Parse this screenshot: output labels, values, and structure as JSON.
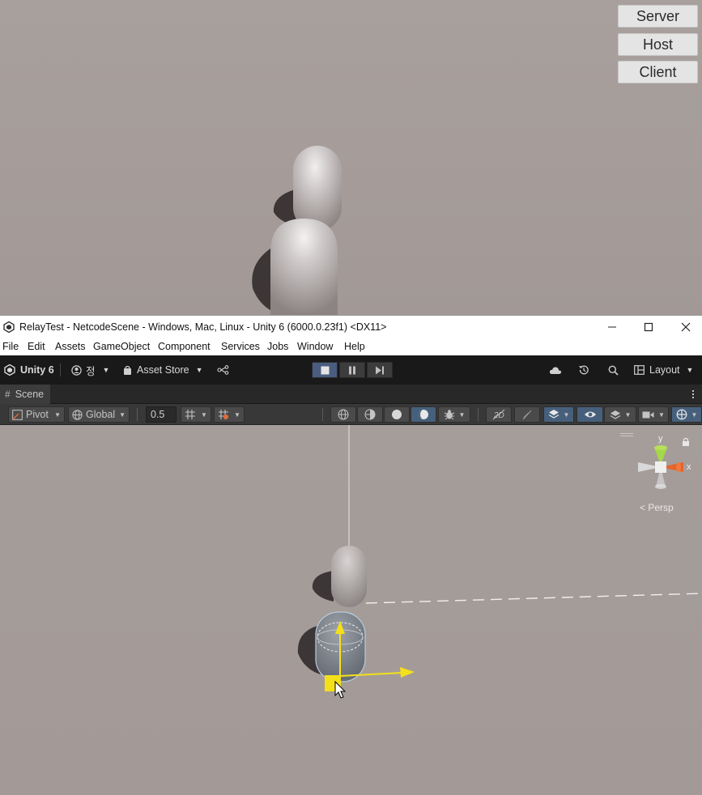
{
  "game_view": {
    "buttons": [
      {
        "label": "Server"
      },
      {
        "label": "Host"
      },
      {
        "label": "Client"
      }
    ]
  },
  "titlebar": {
    "title": "RelayTest - NetcodeScene - Windows, Mac, Linux - Unity 6 (6000.0.23f1) <DX11>",
    "minimize": "—",
    "maximize": "☐",
    "close": "✕"
  },
  "menu": [
    "File",
    "Edit",
    "Assets",
    "GameObject",
    "Component",
    "Services",
    "Jobs",
    "Window",
    "Help"
  ],
  "main_toolbar": {
    "unity_label": "Unity 6",
    "account_label": "정",
    "asset_store_label": "Asset Store",
    "layout_label": "Layout"
  },
  "scene_tab": {
    "label": "Scene"
  },
  "scene_toolbar": {
    "pivot_label": "Pivot",
    "global_label": "Global",
    "snap_value": "0.5"
  },
  "scene_gizmo": {
    "axis_y": "y",
    "axis_x": "x",
    "projection_label": "Persp"
  },
  "colors": {
    "toolbar_bg": "#191919",
    "scene_toolbar_bg": "#383838",
    "accent_active": "#46607c",
    "gizmo_y": "#a6d64a",
    "gizmo_x": "#e6642a",
    "handle_yellow": "#f4e01a"
  }
}
